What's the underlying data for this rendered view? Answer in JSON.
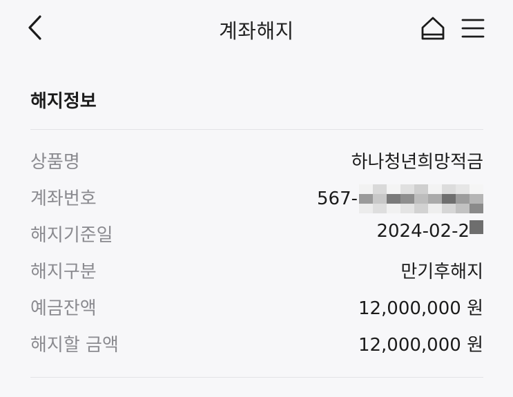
{
  "header": {
    "title": "계좌해지",
    "back_icon": "chevron-left-icon",
    "home_icon": "home-icon",
    "menu_icon": "hamburger-menu-icon"
  },
  "section": {
    "title": "해지정보"
  },
  "details": {
    "product_name": {
      "label": "상품명",
      "value": "하나청년희망적금"
    },
    "account_number": {
      "label": "계좌번호",
      "value": "567-"
    },
    "termination_date": {
      "label": "해지기준일",
      "value": "2024-02-2"
    },
    "termination_type": {
      "label": "해지구분",
      "value": "만기후해지"
    },
    "deposit_balance": {
      "label": "예금잔액",
      "value": "12,000,000 원"
    },
    "termination_amount": {
      "label": "해지할 금액",
      "value": "12,000,000 원"
    }
  }
}
